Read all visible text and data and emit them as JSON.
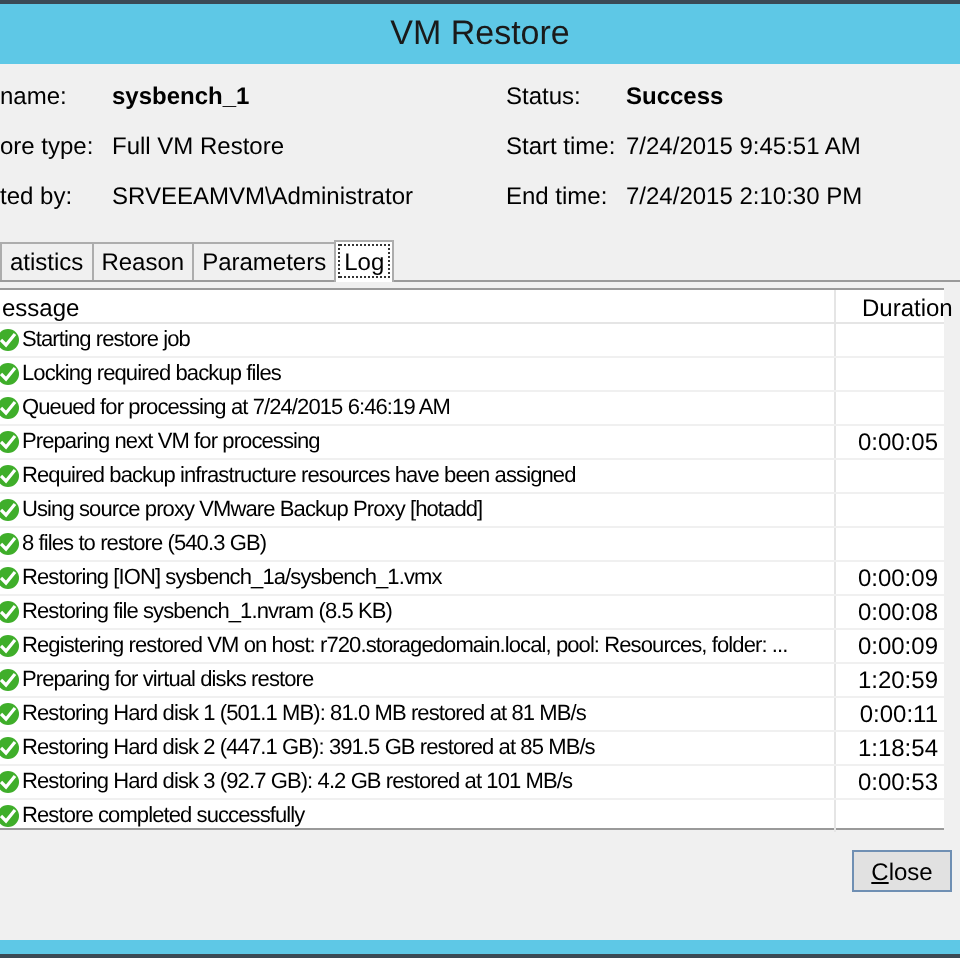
{
  "window": {
    "title": "VM Restore"
  },
  "details": [
    {
      "label": "name:",
      "value": "sysbench_1",
      "bold": true
    },
    {
      "label": "ore type:",
      "value": "Full VM Restore",
      "bold": false
    },
    {
      "label": "ted by:",
      "value": "SRVEEAMVM\\Administrator",
      "bold": false
    }
  ],
  "status": [
    {
      "label": "Status:",
      "value": "Success",
      "bold": true
    },
    {
      "label": "Start time:",
      "value": "7/24/2015 9:45:51 AM",
      "bold": false
    },
    {
      "label": "End time:",
      "value": "7/24/2015 2:10:30 PM",
      "bold": false
    }
  ],
  "tabs": [
    {
      "label": "atistics",
      "selected": false
    },
    {
      "label": "Reason",
      "selected": false
    },
    {
      "label": "Parameters",
      "selected": false
    },
    {
      "label": "Log",
      "selected": true
    }
  ],
  "table": {
    "columns": [
      "essage",
      "Duration"
    ],
    "rows": [
      {
        "message": "Starting restore job",
        "duration": ""
      },
      {
        "message": "Locking required backup files",
        "duration": ""
      },
      {
        "message": "Queued for processing at 7/24/2015 6:46:19 AM",
        "duration": ""
      },
      {
        "message": "Preparing next VM for processing",
        "duration": "0:00:05"
      },
      {
        "message": "Required backup infrastructure resources have been assigned",
        "duration": ""
      },
      {
        "message": "Using source proxy VMware Backup Proxy [hotadd]",
        "duration": ""
      },
      {
        "message": "8 files to restore (540.3 GB)",
        "duration": ""
      },
      {
        "message": "Restoring [ION] sysbench_1a/sysbench_1.vmx",
        "duration": "0:00:09"
      },
      {
        "message": "Restoring file sysbench_1.nvram (8.5 KB)",
        "duration": "0:00:08"
      },
      {
        "message": "Registering restored VM on host: r720.storagedomain.local, pool: Resources, folder: ...",
        "duration": "0:00:09"
      },
      {
        "message": "Preparing for virtual disks restore",
        "duration": "1:20:59"
      },
      {
        "message": "Restoring Hard disk 1 (501.1 MB): 81.0 MB restored at 81 MB/s",
        "duration": "0:00:11"
      },
      {
        "message": "Restoring Hard disk 2 (447.1 GB): 391.5 GB restored at 85 MB/s",
        "duration": "1:18:54"
      },
      {
        "message": "Restoring Hard disk 3 (92.7 GB): 4.2 GB restored at 101 MB/s",
        "duration": "0:00:53"
      },
      {
        "message": "Restore completed successfully",
        "duration": ""
      }
    ]
  },
  "buttons": [
    "Close"
  ]
}
